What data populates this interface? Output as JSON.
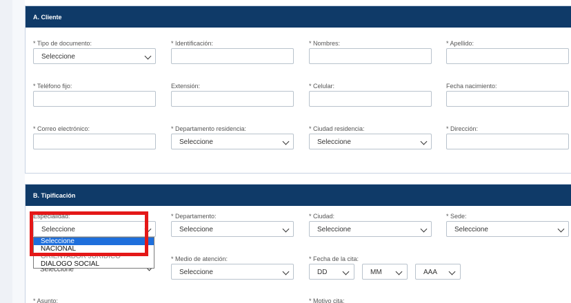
{
  "section_a": {
    "title": "A. Cliente",
    "fields": {
      "tipo_documento": {
        "label": "* Tipo de documento:",
        "value": "Seleccione"
      },
      "identificacion": {
        "label": "* Identificación:",
        "value": ""
      },
      "nombres": {
        "label": "* Nombres:",
        "value": ""
      },
      "apellido": {
        "label": "* Apellido:",
        "value": ""
      },
      "telefono_fijo": {
        "label": "* Teléfono fijo:",
        "value": ""
      },
      "extension": {
        "label": "Extensión:",
        "value": ""
      },
      "celular": {
        "label": "* Celular:",
        "value": ""
      },
      "fecha_nacimiento": {
        "label": "Fecha nacimiento:",
        "value": ""
      },
      "correo": {
        "label": "* Correo electrónico:",
        "value": ""
      },
      "departamento_residencia": {
        "label": "* Departamento residencia:",
        "value": "Seleccione"
      },
      "ciudad_residencia": {
        "label": "* Ciudad residencia:",
        "value": "Seleccione"
      },
      "direccion": {
        "label": "* Dirección:",
        "value": ""
      }
    }
  },
  "section_b": {
    "title": "B. Tipificación",
    "fields": {
      "especialidad": {
        "label": "Especialidad:",
        "value": "Seleccione"
      },
      "departamento": {
        "label": "* Departamento:",
        "value": "Seleccione"
      },
      "ciudad": {
        "label": "* Ciudad:",
        "value": "Seleccione"
      },
      "sede": {
        "label": "* Sede:",
        "value": "Seleccione"
      },
      "tipo_hidden": {
        "value": "Seleccione"
      },
      "medio_atencion": {
        "label": "* Medio de atención:",
        "value": "Seleccione"
      },
      "fecha_cita": {
        "label": "* Fecha de la cita:",
        "dd": "DD",
        "mm": "MM",
        "aaa": "AAA"
      },
      "asunto": {
        "label": "* Asunto:"
      },
      "motivo_cita": {
        "label": "* Motivo cita:"
      }
    },
    "especialidad_options": [
      "Seleccione",
      "NACIONAL",
      "ORIENTADOR JURÍDICO",
      "DIÁLOGO SOCIAL"
    ]
  },
  "colors": {
    "header_bg": "#0f3a68",
    "highlight": "#e41818",
    "option_selected": "#1e6fdc"
  }
}
